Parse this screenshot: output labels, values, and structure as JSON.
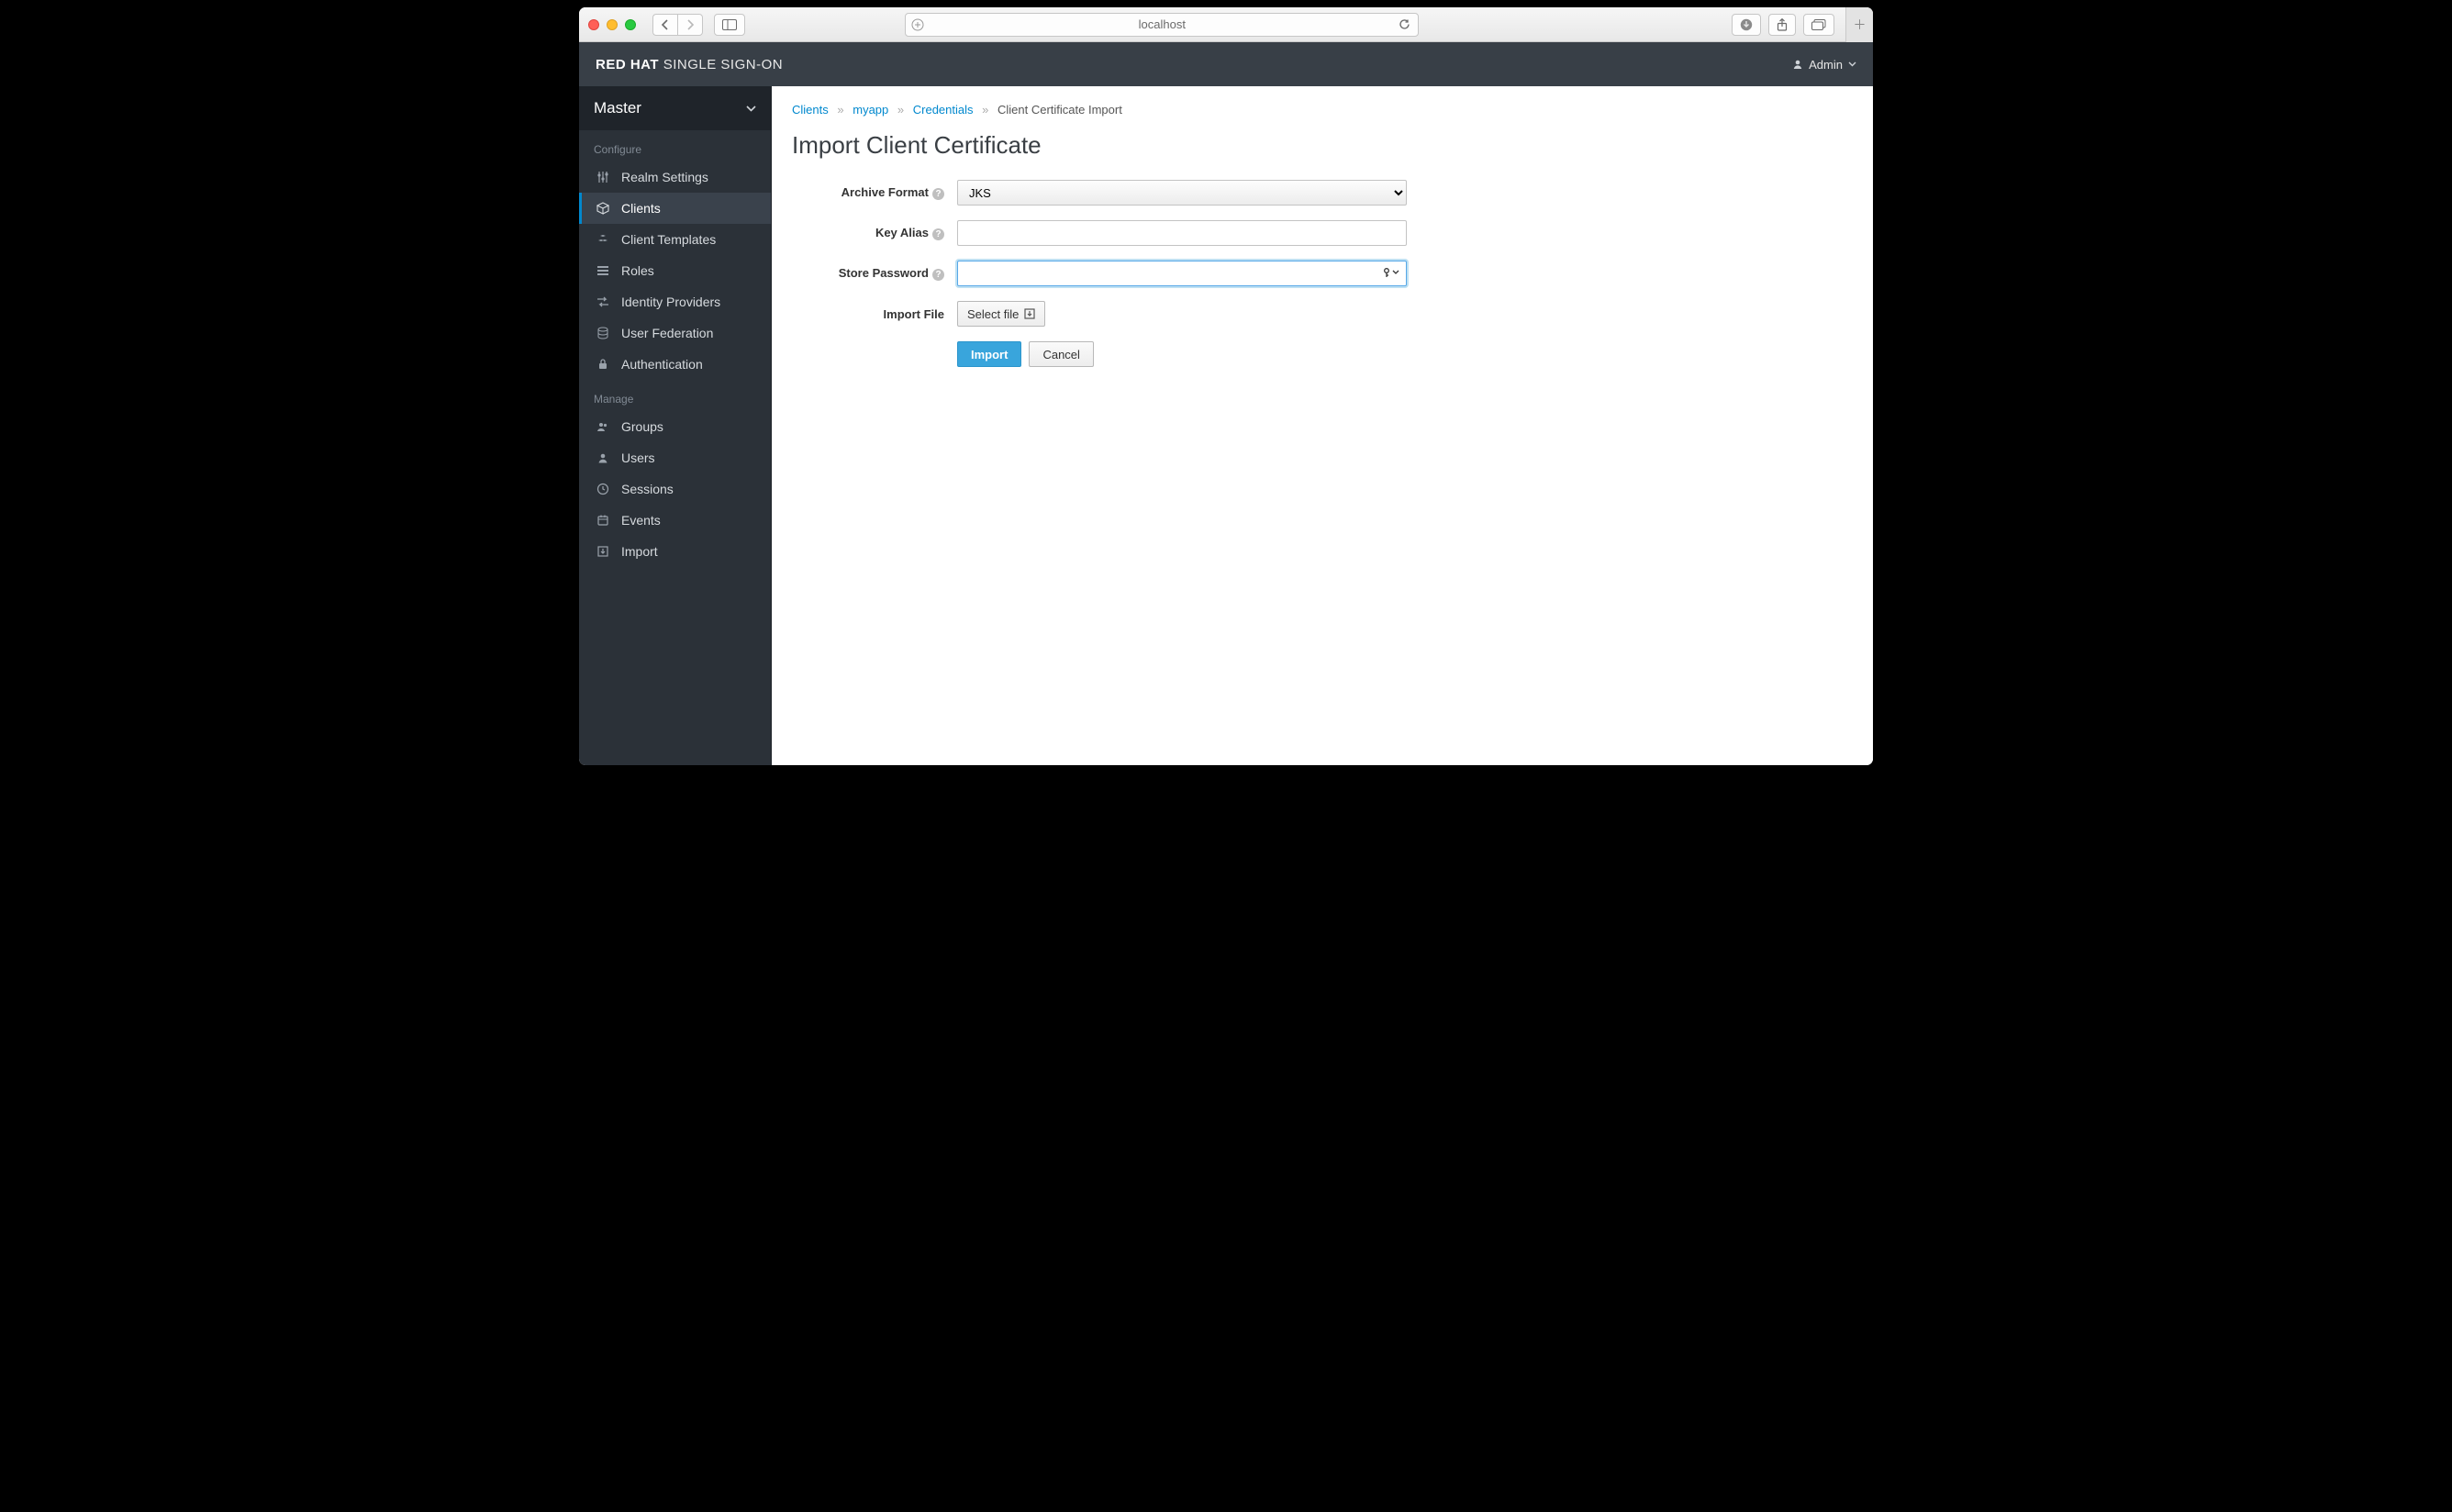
{
  "browser": {
    "host": "localhost"
  },
  "header": {
    "brand_bold": "RED HAT",
    "brand_rest": " SINGLE SIGN-ON",
    "user": "Admin"
  },
  "sidebar": {
    "realm": "Master",
    "sections": {
      "configure": "Configure",
      "manage": "Manage"
    },
    "configure_items": [
      {
        "label": "Realm Settings"
      },
      {
        "label": "Clients"
      },
      {
        "label": "Client Templates"
      },
      {
        "label": "Roles"
      },
      {
        "label": "Identity Providers"
      },
      {
        "label": "User Federation"
      },
      {
        "label": "Authentication"
      }
    ],
    "manage_items": [
      {
        "label": "Groups"
      },
      {
        "label": "Users"
      },
      {
        "label": "Sessions"
      },
      {
        "label": "Events"
      },
      {
        "label": "Import"
      }
    ]
  },
  "breadcrumbs": {
    "items": [
      "Clients",
      "myapp",
      "Credentials"
    ],
    "current": "Client Certificate Import"
  },
  "page": {
    "title": "Import Client Certificate",
    "labels": {
      "archive_format": "Archive Format",
      "key_alias": "Key Alias",
      "store_password": "Store Password",
      "import_file": "Import File"
    },
    "archive_format_value": "JKS",
    "key_alias_value": "",
    "store_password_value": "",
    "select_file_label": "Select file",
    "buttons": {
      "import": "Import",
      "cancel": "Cancel"
    }
  }
}
